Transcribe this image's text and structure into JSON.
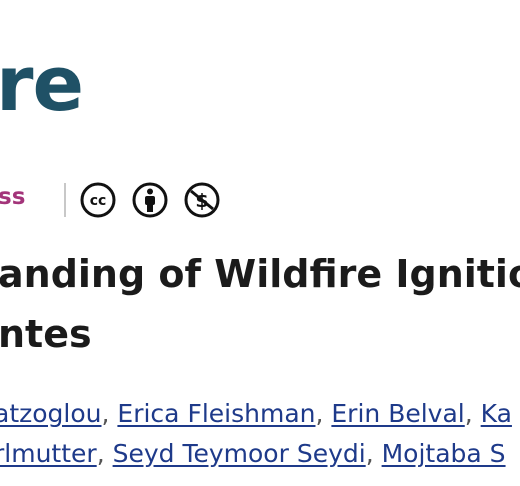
{
  "logo": {
    "text": "re"
  },
  "access": {
    "label": "ss"
  },
  "license_icons": [
    "cc-icon",
    "attribution-icon",
    "noncommercial-icon"
  ],
  "article": {
    "title_line1": "anding of Wildfire Ignitio",
    "title_line2": "ntes"
  },
  "authors": {
    "line1": [
      "atzoglou",
      "Erica Fleishman",
      "Erin Belval",
      "Ka"
    ],
    "line2": [
      "rlmutter",
      "Seyd Teymoor Seydi",
      "Mojtaba S"
    ],
    "separator": ","
  },
  "colors": {
    "logo": "#1f5166",
    "access": "#a3347a",
    "link": "#1e3a8a",
    "title": "#1b1b1b"
  }
}
